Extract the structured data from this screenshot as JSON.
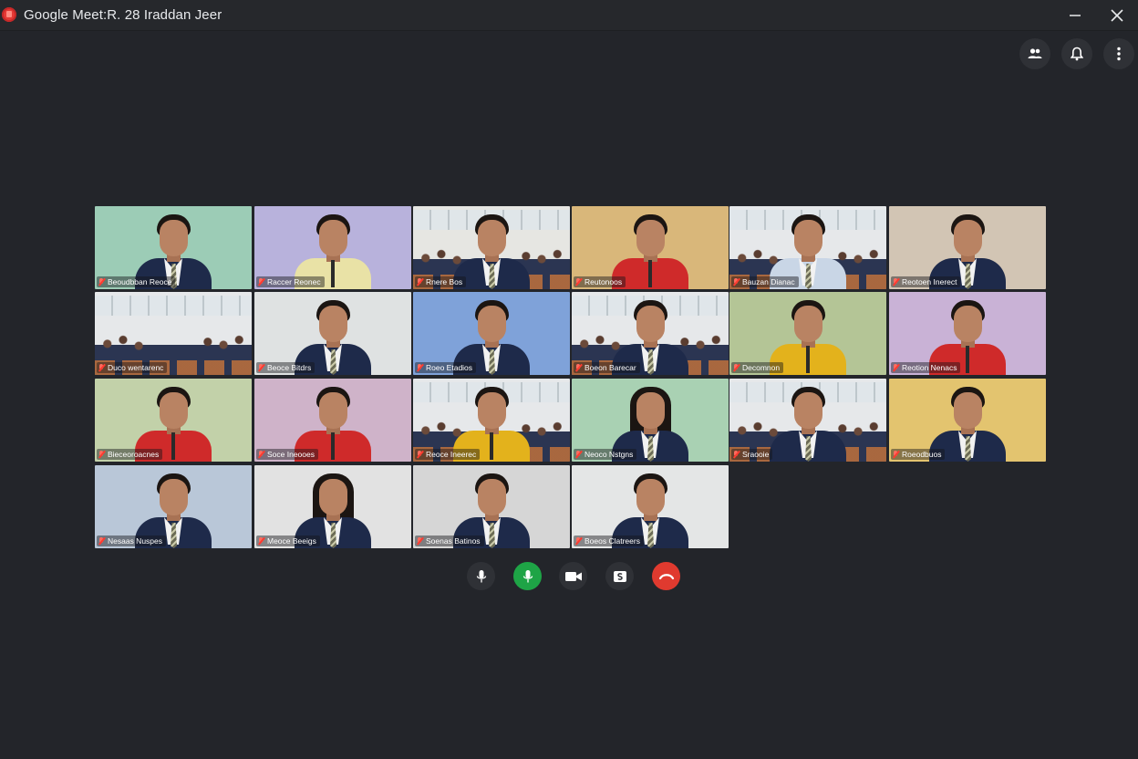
{
  "window": {
    "title": "Google Meet:R. 28 Iraddan Jeer"
  },
  "top_actions": {
    "people_icon": "people-icon",
    "bell_icon": "bell-icon",
    "more_icon": "more-vert-icon"
  },
  "participants": [
    {
      "name": "Beoudbban Reoce",
      "bg": "#9cccb6",
      "style": "blazer",
      "scene": "plain"
    },
    {
      "name": "Raccer Reonec",
      "bg": "#b8b2dc",
      "style": "shirt-cream",
      "scene": "plain"
    },
    {
      "name": "Rnere Bos",
      "bg": "#e6e6e2",
      "style": "blazer",
      "scene": "classroom"
    },
    {
      "name": "Reutonoos",
      "bg": "#d9b77a",
      "style": "shirt-red",
      "scene": "plain"
    },
    {
      "name": "Bauzan Dianac",
      "bg": "#e6e8ea",
      "style": "shirt-light",
      "scene": "classroom"
    },
    {
      "name": "Reotoen Inerect",
      "bg": "#d2c5b4",
      "style": "blazer",
      "scene": "plain"
    },
    {
      "name": "Duco wentarenc",
      "bg": "#e6e8ea",
      "style": "none",
      "scene": "classroom"
    },
    {
      "name": "Beoce Bitdrs",
      "bg": "#dfe2e2",
      "style": "blazer",
      "scene": "plain"
    },
    {
      "name": "Roeo Etadios",
      "bg": "#7fa2d9",
      "style": "blazer",
      "scene": "plain"
    },
    {
      "name": "Boeon Barecar",
      "bg": "#e6e8ea",
      "style": "blazer",
      "scene": "classroom"
    },
    {
      "name": "Decomnon",
      "bg": "#b4c596",
      "style": "shirt-yellow",
      "scene": "plain"
    },
    {
      "name": "Reotion Nenacs",
      "bg": "#c9b2d6",
      "style": "shirt-red",
      "scene": "plain"
    },
    {
      "name": "Bieceoroacnes",
      "bg": "#c2d1a9",
      "style": "shirt-red",
      "scene": "plain"
    },
    {
      "name": "Soce Ineooes",
      "bg": "#cfb3c9",
      "style": "shirt-red",
      "scene": "plain"
    },
    {
      "name": "Reoce Ineerec",
      "bg": "#e6e8ea",
      "style": "shirt-yellow",
      "scene": "classroom"
    },
    {
      "name": "Neoco Nstgns",
      "bg": "#a9d1b3",
      "style": "blazer",
      "scene": "plain",
      "longhair": true
    },
    {
      "name": "Sraooie",
      "bg": "#e6e8ea",
      "style": "blazer",
      "scene": "classroom"
    },
    {
      "name": "Roeodbuos",
      "bg": "#e3c46f",
      "style": "blazer",
      "scene": "plain"
    },
    {
      "name": "Nesaas Nuspes",
      "bg": "#b9c7d8",
      "style": "blazer",
      "scene": "plain"
    },
    {
      "name": "Meoce Beeigs",
      "bg": "#e2e2e2",
      "style": "blazer",
      "scene": "plain",
      "longhair": true
    },
    {
      "name": "Soenas Batinos",
      "bg": "#d6d6d6",
      "style": "blazer",
      "scene": "plain"
    },
    {
      "name": "Boeos Clatreers",
      "bg": "#e4e6e6",
      "style": "blazer",
      "scene": "plain"
    }
  ],
  "controls": {
    "mic_icon": "mic-icon",
    "mic_active_icon": "mic-active-icon",
    "camera_icon": "camera-icon",
    "present_icon": "present-icon",
    "end_call_icon": "end-call-icon",
    "end_call_color": "#e03a2f",
    "mic_active_color": "#1ea446"
  },
  "colors": {
    "background": "#23252a",
    "titlebar": "#26282c"
  }
}
